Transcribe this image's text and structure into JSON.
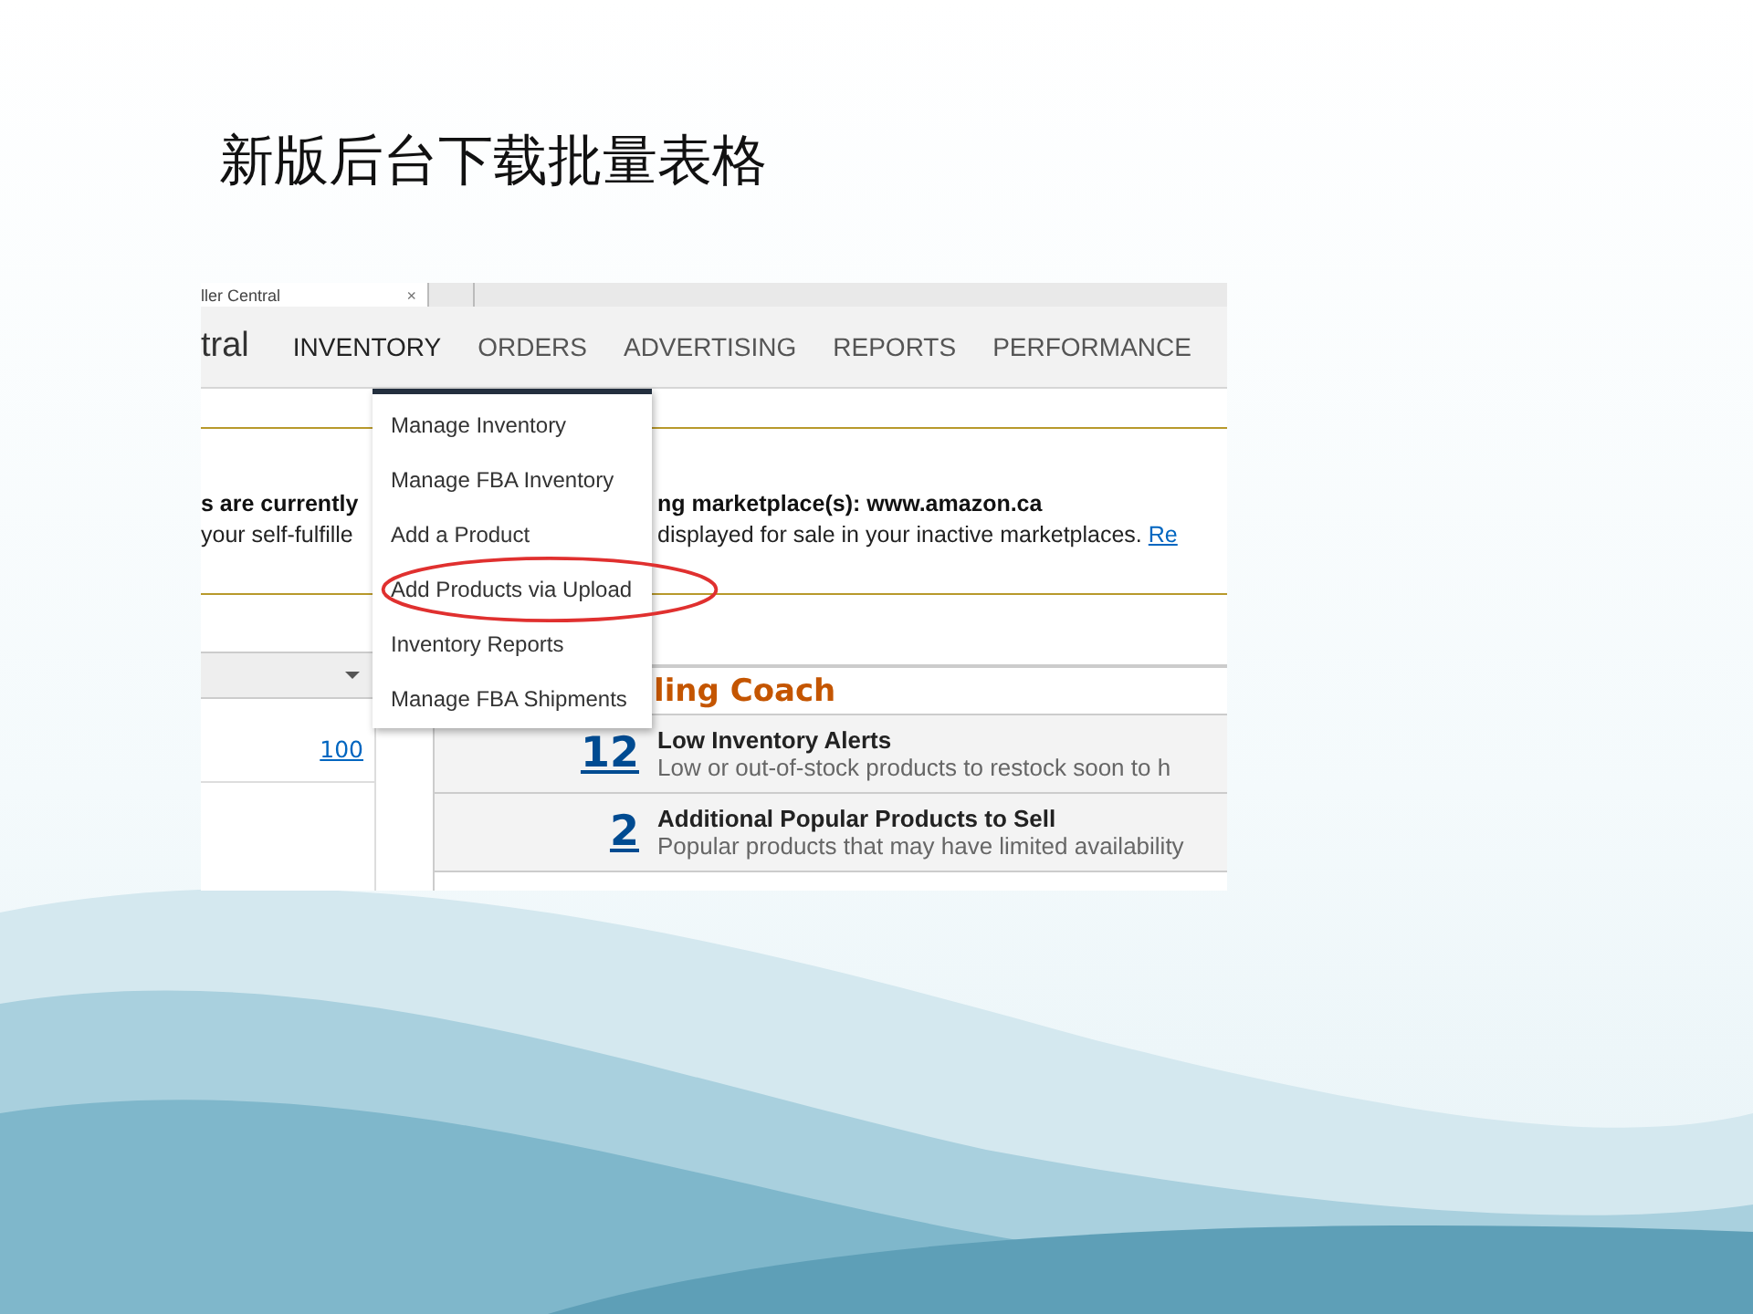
{
  "slide": {
    "title": "新版后台下载批量表格"
  },
  "browser_tab": {
    "title": "ller Central",
    "close": "×"
  },
  "header": {
    "logo_text": "tral",
    "nav": [
      {
        "label": "INVENTORY",
        "selected": true
      },
      {
        "label": "ORDERS",
        "selected": false
      },
      {
        "label": "ADVERTISING",
        "selected": false
      },
      {
        "label": "REPORTS",
        "selected": false
      },
      {
        "label": "PERFORMANCE",
        "selected": false
      }
    ]
  },
  "menu": {
    "items": [
      {
        "label": "Manage Inventory",
        "highlighted": false
      },
      {
        "label": "Manage FBA Inventory",
        "highlighted": false
      },
      {
        "label": "Add a Product",
        "highlighted": false
      },
      {
        "label": "Add Products via Upload",
        "highlighted": true
      },
      {
        "label": "Inventory Reports",
        "highlighted": false
      },
      {
        "label": "Manage FBA Shipments",
        "highlighted": false
      }
    ]
  },
  "notice": {
    "line_1_left": "s are currently",
    "line_1_right": "ng marketplace(s): www.amazon.ca",
    "line_2_left": "your self-fulfille",
    "line_2_right": "displayed for sale in your inactive marketplaces.",
    "line_2_link": "Re"
  },
  "left_panel": {
    "link": "100"
  },
  "coach": {
    "title": "ling Coach",
    "rows": [
      {
        "count": "12",
        "title": "Low Inventory Alerts",
        "description": "Low or out-of-stock products to restock soon to h"
      },
      {
        "count": "2",
        "title": "Additional Popular Products to Sell",
        "description": "Popular products that may have limited availability"
      }
    ]
  }
}
